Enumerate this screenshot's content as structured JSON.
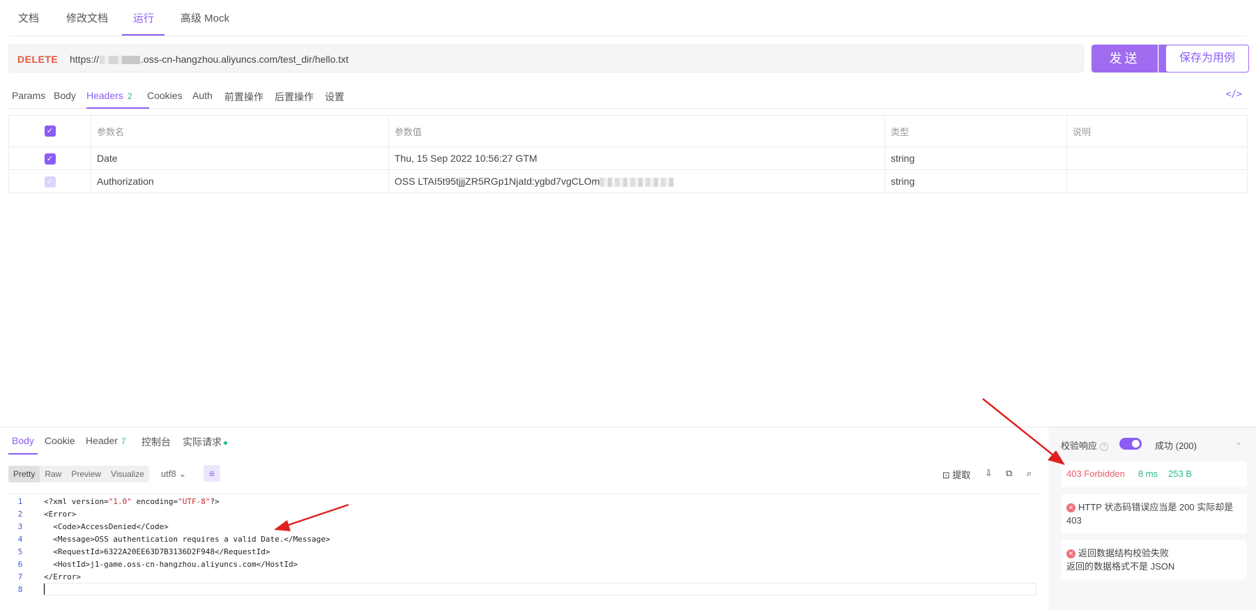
{
  "top_tabs": [
    "文档",
    "修改文档",
    "运行",
    "高级 Mock"
  ],
  "request": {
    "method": "DELETE",
    "url_prefix": "https://",
    "url_suffix": ".oss-cn-hangzhou.aliyuncs.com/test_dir/hello.txt",
    "send_label": "发送",
    "save_label": "保存为用例"
  },
  "sub_tabs": {
    "params": "Params",
    "body": "Body",
    "headers": "Headers",
    "headers_count": "2",
    "cookies": "Cookies",
    "auth": "Auth",
    "pre": "前置操作",
    "post": "后置操作",
    "settings": "设置",
    "code_icon": "</>"
  },
  "table": {
    "headers": [
      "参数名",
      "参数值",
      "类型",
      "说明"
    ],
    "rows": [
      {
        "name": "Date",
        "value": "Thu, 15 Sep 2022 10:56:27 GTM",
        "type": "string",
        "desc": "",
        "checked": true
      },
      {
        "name": "Authorization",
        "value": "OSS LTAI5t95tjjjZR5RGp1Njatd:ygbd7vgCLOm",
        "type": "string",
        "desc": "",
        "checked": false
      }
    ]
  },
  "response": {
    "tabs": {
      "body": "Body",
      "cookie": "Cookie",
      "header": "Header",
      "header_count": "7",
      "console": "控制台",
      "actual": "实际请求"
    },
    "formats": [
      "Pretty",
      "Raw",
      "Preview",
      "Visualize"
    ],
    "encoding": "utf8",
    "tools": {
      "extract": "提取"
    },
    "code_lines": [
      {
        "n": "1",
        "t": "<?xml version=\"1.0\" encoding=\"UTF-8\"?>"
      },
      {
        "n": "2",
        "t": "<Error>"
      },
      {
        "n": "3",
        "t": "  <Code>AccessDenied</Code>"
      },
      {
        "n": "4",
        "t": "  <Message>OSS authentication requires a valid Date.</Message>"
      },
      {
        "n": "5",
        "t": "  <RequestId>6322A20EE63D7B3136D2F948</RequestId>"
      },
      {
        "n": "6",
        "t": "  <HostId>j1-game.oss-cn-hangzhou.aliyuncs.com</HostId>"
      },
      {
        "n": "7",
        "t": "</Error>"
      },
      {
        "n": "8",
        "t": ""
      }
    ]
  },
  "validation": {
    "label": "校验响应",
    "result": "成功 (200)",
    "status_code": "403 Forbidden",
    "time": "8 ms",
    "size": "253 B",
    "error1": "HTTP 状态码错误应当是 200 实际却是 403",
    "error2_title": "返回数据结构校验失败",
    "error2_detail": "返回的数据格式不是 JSON"
  },
  "colors": {
    "accent": "#8b5cf6",
    "method": "#e8553a",
    "error": "#f05a6a",
    "success": "#26b892",
    "arrow": "#e02020"
  }
}
